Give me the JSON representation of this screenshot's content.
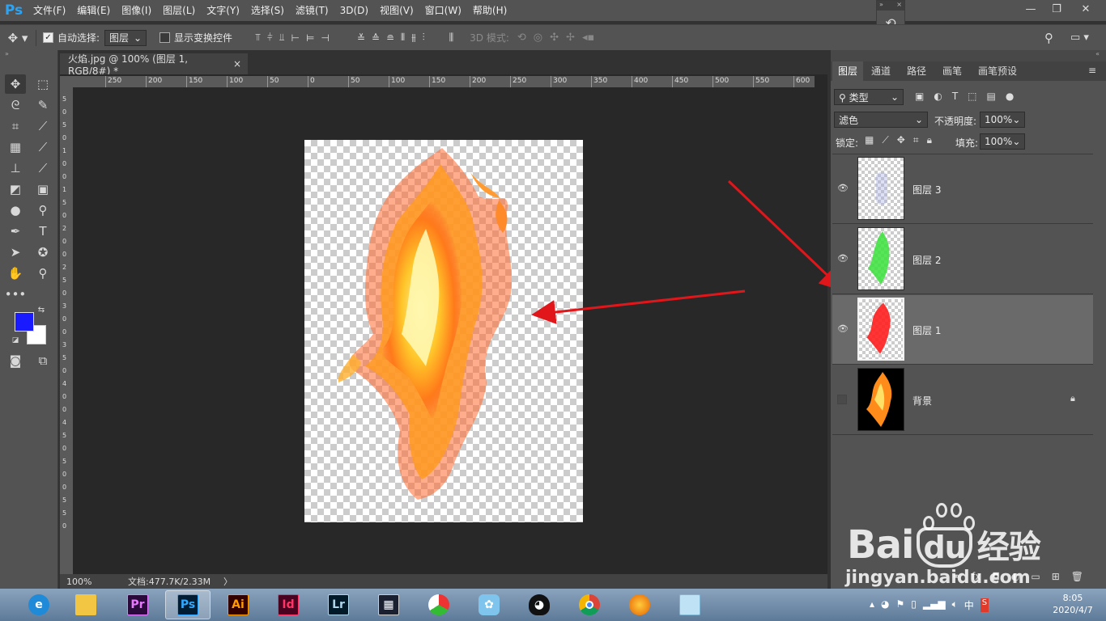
{
  "app": {
    "logo": "Ps"
  },
  "menu": [
    "文件(F)",
    "编辑(E)",
    "图像(I)",
    "图层(L)",
    "文字(Y)",
    "选择(S)",
    "滤镜(T)",
    "3D(D)",
    "视图(V)",
    "窗口(W)",
    "帮助(H)"
  ],
  "window_controls": {
    "minimize": "—",
    "restore": "❐",
    "close": "✕"
  },
  "options": {
    "auto_select_label": "自动选择:",
    "auto_select_checked": true,
    "auto_select_value": "图层",
    "show_transform_label": "显示变换控件",
    "show_transform_checked": false,
    "mode_3d_label": "3D 模式:"
  },
  "document": {
    "tab_title": "火焰.jpg @ 100% (图层 1, RGB/8#) *",
    "tab_close": "×",
    "ruler_top_ticks": [
      "250",
      "200",
      "150",
      "100",
      "50",
      "0",
      "50",
      "100",
      "150",
      "200",
      "250",
      "300",
      "350",
      "400",
      "450",
      "500",
      "550",
      "600"
    ],
    "ruler_left_ticks": [
      "5",
      "0",
      "5",
      "0",
      "1",
      "0",
      "0",
      "1",
      "5",
      "0",
      "2",
      "0",
      "0",
      "2",
      "5",
      "0",
      "3",
      "0",
      "0",
      "3",
      "5",
      "0",
      "4",
      "0",
      "0",
      "4",
      "5",
      "0",
      "5",
      "0",
      "0",
      "5",
      "5",
      "0"
    ]
  },
  "status": {
    "zoom": "100%",
    "doc_info": "文档:477.7K/2.33M",
    "arrow": "〉"
  },
  "colors": {
    "foreground": "#1a1aff",
    "background": "#ffffff",
    "annotation_arrow": "#e0161b"
  },
  "panel": {
    "tabs": [
      "图层",
      "通道",
      "路径",
      "画笔",
      "画笔预设"
    ],
    "active_tab": "图层",
    "filter_type": "类型",
    "blend_mode": "滤色",
    "opacity_label": "不透明度:",
    "opacity_value": "100%",
    "lock_label": "锁定:",
    "fill_label": "填充:",
    "fill_value": "100%",
    "layers": [
      {
        "name": "图层 3",
        "visible": true,
        "selected": false,
        "locked": false,
        "thumb": "blue-faint"
      },
      {
        "name": "图层 2",
        "visible": true,
        "selected": false,
        "locked": false,
        "thumb": "green"
      },
      {
        "name": "图层 1",
        "visible": true,
        "selected": true,
        "locked": false,
        "thumb": "red"
      },
      {
        "name": "背景",
        "visible": false,
        "selected": false,
        "locked": true,
        "thumb": "fire"
      }
    ]
  },
  "taskbar": {
    "apps": [
      "ie",
      "explorer",
      "Pr",
      "Ps",
      "Ai",
      "Id",
      "Lr",
      "media",
      "photo",
      "bird",
      "qq",
      "chrome",
      "firefox",
      "notes"
    ],
    "active_app": "Ps",
    "tray_ime": "中",
    "time": "8:05",
    "date": "2020/4/7"
  },
  "watermark": {
    "brand": "Bai",
    "brand2": "du",
    "cn": "经验",
    "url": "jingyan.baidu.com"
  }
}
